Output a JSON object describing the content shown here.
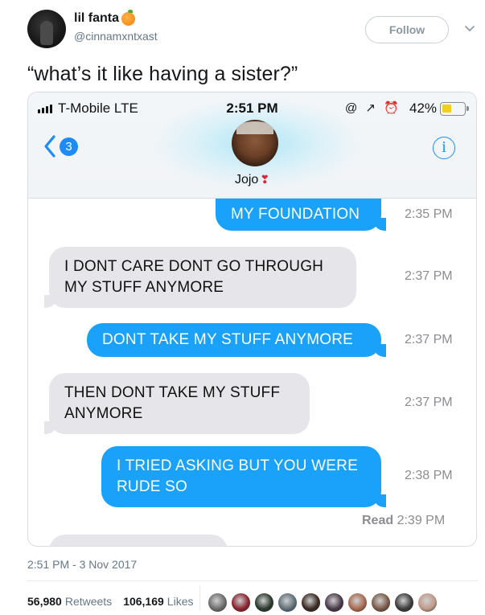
{
  "tweet": {
    "display_name": "lil fanta",
    "emoji_icon": "orange-icon",
    "handle": "@cinnamxntxast",
    "follow_label": "Follow",
    "text": "“what’s it like having a sister?”",
    "timestamp": "2:51 PM - 3 Nov 2017",
    "retweets_count": "56,980",
    "retweets_label": "Retweets",
    "likes_count": "106,169",
    "likes_label": "Likes",
    "liker_avatar_colors": [
      "#6d6d6d",
      "#8a2530",
      "#2b3a2c",
      "#5f6f7a",
      "#3a2a22",
      "#4a3a4a",
      "#a86a52",
      "#7a5a48",
      "#3c3c3c",
      "#c09a8a"
    ]
  },
  "phone": {
    "status": {
      "carrier": "T-Mobile  LTE",
      "time": "2:51 PM",
      "icons": "@ ↗ ⏰",
      "battery": "42%",
      "battery_level": 0.42,
      "battery_color": "#f4cf19"
    },
    "back_count": "3",
    "contact_name": "Jojo",
    "contact_emoji": "❣",
    "info_label": "i",
    "sent_color": "#1aa1f9",
    "received_color": "#e6e6ea",
    "messages": [
      {
        "side": "sent",
        "line1": "MY FOUNDATION",
        "line2": "",
        "time": "2:35 PM"
      },
      {
        "side": "received",
        "line1": "I DONT CARE DONT GO THROUGH",
        "line2": "MY STUFF ANYMORE",
        "time": "2:37 PM"
      },
      {
        "side": "sent",
        "line1": "DONT TAKE MY STUFF ANYMORE",
        "line2": "",
        "time": "2:37 PM"
      },
      {
        "side": "received",
        "line1": "THEN DONT TAKE MY STUFF",
        "line2": "ANYMORE",
        "time": "2:37 PM"
      },
      {
        "side": "sent",
        "line1": "I TRIED ASKING BUT YOU WERE",
        "line2": "RUDE SO",
        "time": "2:38 PM"
      }
    ],
    "read_label": "Read",
    "read_time": "2:39 PM"
  }
}
